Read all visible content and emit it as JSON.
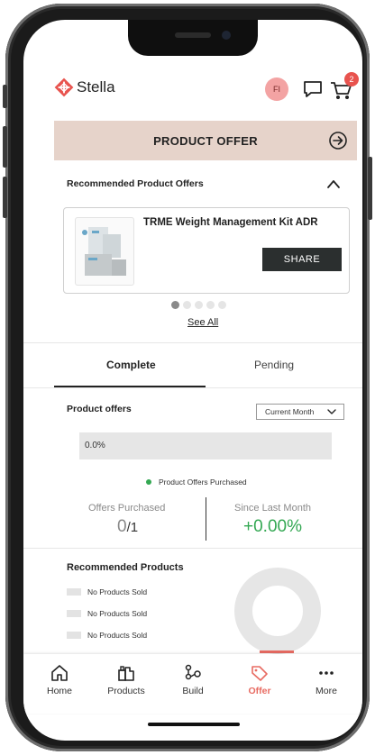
{
  "app": {
    "name": "Stella",
    "brand_color": "#e8534e"
  },
  "header": {
    "avatar_initials": "FI",
    "cart_count": "2",
    "icons": [
      "chat-icon",
      "cart-icon"
    ]
  },
  "offer_banner": {
    "title": "PRODUCT OFFER",
    "icon": "arrow-right-circle-icon"
  },
  "recommended_offers": {
    "title": "Recommended Product Offers",
    "cards": [
      {
        "product_name": "TRME Weight Management Kit ADR",
        "share_label": "SHARE"
      }
    ],
    "carousel": {
      "count": 5,
      "active_index": 0
    },
    "see_all_label": "See All"
  },
  "tabs": [
    {
      "label": "Complete",
      "active": true
    },
    {
      "label": "Pending",
      "active": false
    }
  ],
  "product_offers": {
    "title": "Product offers",
    "period_select": "Current Month",
    "progress_percent": 0,
    "progress_label": "0.0%",
    "legend_label": "Product Offers Purchased",
    "legend_color": "#34a853",
    "stats": {
      "purchased_label": "Offers Purchased",
      "purchased_value": "0",
      "purchased_total": "/1",
      "since_label": "Since Last Month",
      "since_value": "+0.00%"
    }
  },
  "recommended_products": {
    "title": "Recommended Products",
    "items": [
      "No Products Sold",
      "No Products Sold",
      "No Products Sold"
    ]
  },
  "bottom_nav": [
    {
      "label": "Home",
      "icon": "home-icon",
      "active": false
    },
    {
      "label": "Products",
      "icon": "products-icon",
      "active": false
    },
    {
      "label": "Build",
      "icon": "build-icon",
      "active": false
    },
    {
      "label": "Offer",
      "icon": "offer-tag-icon",
      "active": true
    },
    {
      "label": "More",
      "icon": "more-icon",
      "active": false
    }
  ]
}
